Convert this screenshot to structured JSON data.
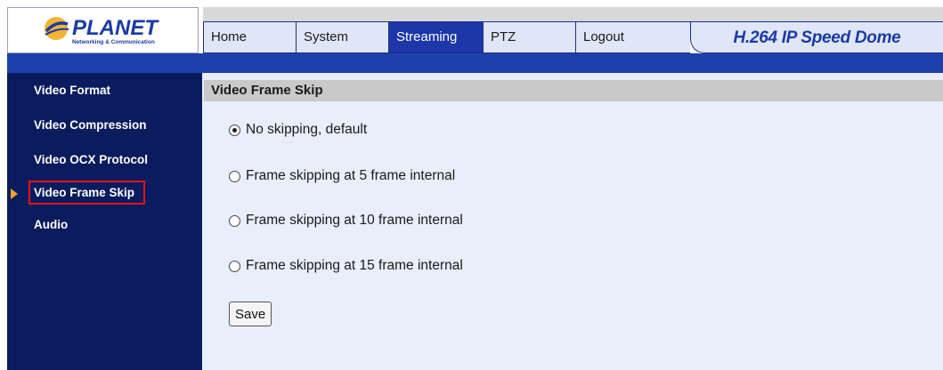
{
  "logo": {
    "brand": "PLANET",
    "tagline": "Networking & Communication"
  },
  "nav": {
    "tabs": [
      {
        "label": "Home",
        "active": false
      },
      {
        "label": "System",
        "active": false
      },
      {
        "label": "Streaming",
        "active": true
      },
      {
        "label": "PTZ",
        "active": false
      },
      {
        "label": "Logout",
        "active": false
      }
    ],
    "product_title": "H.264 IP Speed Dome"
  },
  "sidebar": {
    "items": [
      {
        "label": "Video Format",
        "selected": false
      },
      {
        "label": "Video Compression",
        "selected": false
      },
      {
        "label": "Video OCX Protocol",
        "selected": false
      },
      {
        "label": "Video Frame Skip",
        "selected": true
      },
      {
        "label": "Audio",
        "selected": false
      }
    ]
  },
  "content": {
    "title": "Video Frame Skip",
    "options": [
      {
        "label": "No skipping, default",
        "checked": true
      },
      {
        "label": "Frame skipping at 5 frame internal",
        "checked": false
      },
      {
        "label": "Frame skipping at 10 frame internal",
        "checked": false
      },
      {
        "label": "Frame skipping at 15 frame internal",
        "checked": false
      }
    ],
    "save_label": "Save"
  },
  "colors": {
    "nav_active": "#1d36a8",
    "sidebar_bg": "#0a1c5e",
    "band": "#1e40aa",
    "content_bg": "#e9eefb",
    "selected_outline": "#e01515",
    "arrow": "#f5a030"
  }
}
